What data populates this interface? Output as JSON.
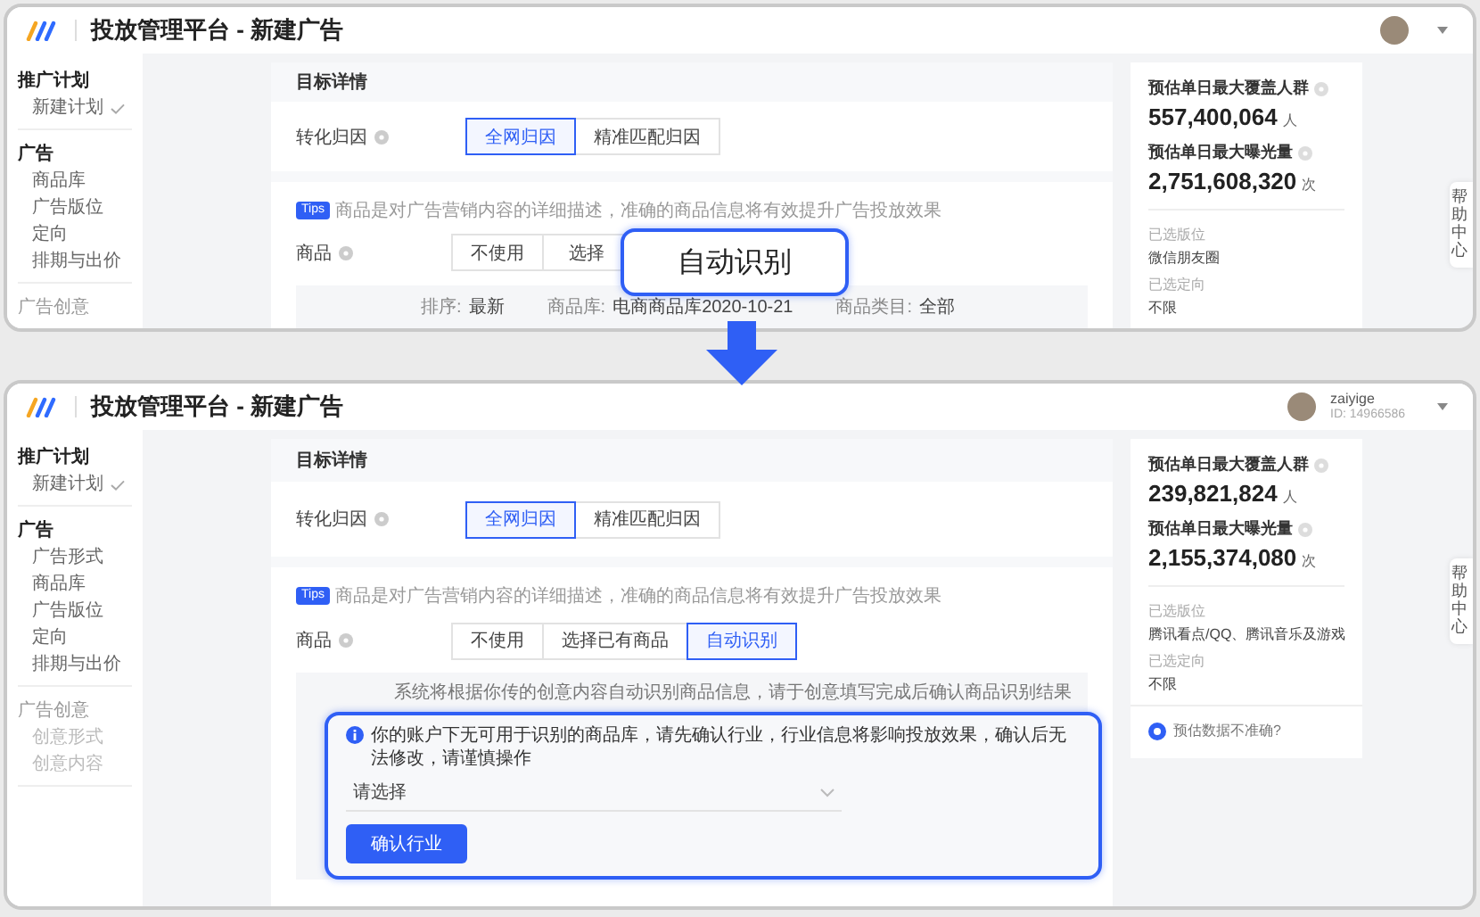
{
  "screens": [
    {
      "header": {
        "title": "投放管理平台 - 新建广告"
      },
      "sidebar": [
        {
          "title": "推广计划",
          "disabled": false,
          "items": [
            {
              "label": "新建计划",
              "checked": true
            }
          ]
        },
        {
          "title": "广告",
          "disabled": false,
          "items": [
            {
              "label": "商品库",
              "checked": false
            },
            {
              "label": "广告版位",
              "checked": false
            },
            {
              "label": "定向",
              "checked": false
            },
            {
              "label": "排期与出价",
              "checked": false
            }
          ]
        },
        {
          "title": "广告创意",
          "disabled": true
        }
      ],
      "main": {
        "section_title": "目标详情",
        "attribution": {
          "label": "转化归因",
          "options": [
            {
              "label": "全网归因",
              "selected": true
            },
            {
              "label": "精准匹配归因",
              "selected": false
            }
          ]
        },
        "tips": {
          "badge": "Tips",
          "text": "商品是对广告营销内容的详细描述，准确的商品信息将有效提升广告投放效果"
        },
        "goods": {
          "label": "商品",
          "options": [
            {
              "label": "不使用",
              "selected": false
            },
            {
              "label": "选择",
              "selected": false
            }
          ]
        },
        "filters": [
          {
            "label": "排序:",
            "value": "最新"
          },
          {
            "label": "商品库:",
            "value": "电商商品库2020-10-21"
          },
          {
            "label": "商品类目:",
            "value": "全部"
          }
        ]
      },
      "panel": {
        "stats": [
          {
            "label": "预估单日最大覆盖人群",
            "value": "557,400,064",
            "unit": "人"
          },
          {
            "label": "预估单日最大曝光量",
            "value": "2,751,608,320",
            "unit": "次"
          }
        ],
        "selections": [
          {
            "label": "已选版位",
            "value": "微信朋友圈"
          },
          {
            "label": "已选定向",
            "value": "不限"
          }
        ]
      },
      "help_tab": "帮助中心"
    },
    {
      "header": {
        "title": "投放管理平台 - 新建广告",
        "user": {
          "name": "zaiyige",
          "id": "ID: 14966586"
        }
      },
      "sidebar": [
        {
          "title": "推广计划",
          "disabled": false,
          "items": [
            {
              "label": "新建计划",
              "checked": true
            }
          ]
        },
        {
          "title": "广告",
          "disabled": false,
          "items": [
            {
              "label": "广告形式",
              "checked": false
            },
            {
              "label": "商品库",
              "checked": false
            },
            {
              "label": "广告版位",
              "checked": false
            },
            {
              "label": "定向",
              "checked": false
            },
            {
              "label": "排期与出价",
              "checked": false
            }
          ]
        },
        {
          "title": "广告创意",
          "disabled": true,
          "items": [
            {
              "label": "创意形式",
              "checked": false
            },
            {
              "label": "创意内容",
              "checked": false
            }
          ]
        }
      ],
      "main": {
        "section_title": "目标详情",
        "attribution": {
          "label": "转化归因",
          "options": [
            {
              "label": "全网归因",
              "selected": true
            },
            {
              "label": "精准匹配归因",
              "selected": false
            }
          ]
        },
        "tips": {
          "badge": "Tips",
          "text": "商品是对广告营销内容的详细描述，准确的商品信息将有效提升广告投放效果"
        },
        "goods": {
          "label": "商品",
          "options": [
            {
              "label": "不使用",
              "selected": false
            },
            {
              "label": "选择已有商品",
              "selected": false
            },
            {
              "label": "自动识别",
              "selected": true
            }
          ]
        },
        "auto_notice": "系统将根据你传的创意内容自动识别商品信息，请于创意填写完成后确认商品识别结果",
        "dialog": {
          "notice": "你的账户下无可用于识别的商品库，请先确认行业，行业信息将影响投放效果，确认后无法修改，请谨慎操作",
          "select_placeholder": "请选择",
          "button": "确认行业"
        }
      },
      "panel": {
        "stats": [
          {
            "label": "预估单日最大覆盖人群",
            "value": "239,821,824",
            "unit": "人"
          },
          {
            "label": "预估单日最大曝光量",
            "value": "2,155,374,080",
            "unit": "次"
          }
        ],
        "selections": [
          {
            "label": "已选版位",
            "value": "腾讯看点/QQ、腾讯音乐及游戏"
          },
          {
            "label": "已选定向",
            "value": "不限"
          }
        ],
        "feedback_link": "预估数据不准确?"
      },
      "help_tab": "帮助中心"
    }
  ],
  "callout": "自动识别"
}
